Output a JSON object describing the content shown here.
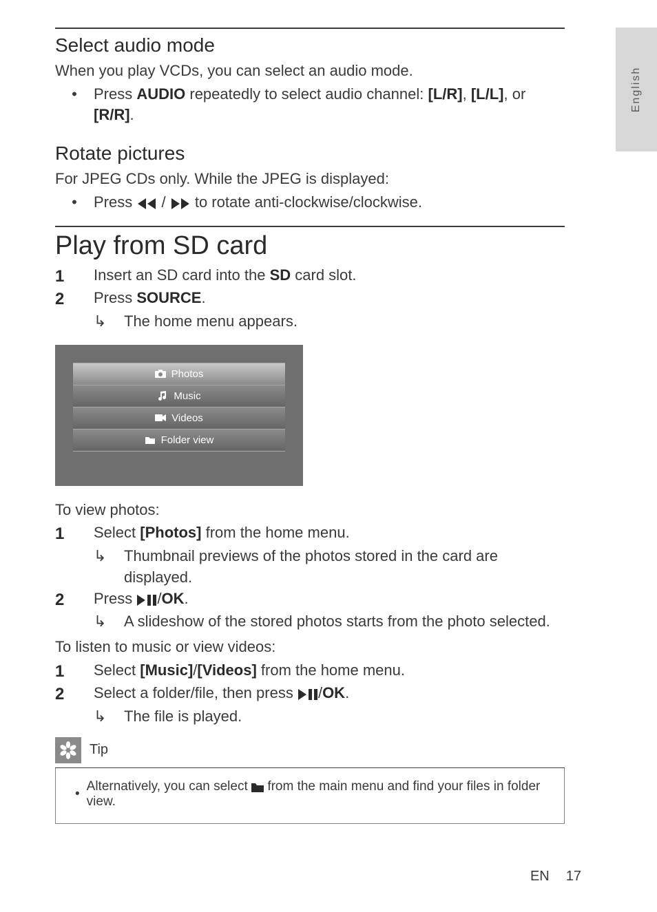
{
  "side_tab": "English",
  "sec_audio": {
    "heading": "Select audio mode",
    "intro": "When you play VCDs, you can select an audio mode.",
    "bullet_pre": "Press ",
    "bullet_bold": "AUDIO",
    "bullet_mid": " repeatedly to select audio channel: ",
    "opt1": "[L/R]",
    "sep": ", ",
    "opt2": "[L/L]",
    "sep2": ", or ",
    "opt3": "[R/R]",
    "period": "."
  },
  "sec_rotate": {
    "heading": "Rotate pictures",
    "intro": "For JPEG CDs only. While the JPEG is displayed:",
    "bullet_pre": "Press ",
    "bullet_mid": "/ ",
    "bullet_post": " to rotate anti-clockwise/clockwise."
  },
  "sec_sd": {
    "heading": "Play from SD card",
    "step1_pre": "Insert an SD card into the ",
    "step1_bold": "SD",
    "step1_post": " card slot.",
    "step2_pre": "Press ",
    "step2_bold": "SOURCE",
    "step2_post": ".",
    "step2_sub": "The home menu appears.",
    "menu": {
      "photos": "Photos",
      "music": "Music",
      "videos": "Videos",
      "folder": "Folder view"
    },
    "photos_intro": "To view photos:",
    "p_step1_pre": "Select ",
    "p_step1_bold": "[Photos]",
    "p_step1_post": " from the home menu.",
    "p_step1_sub": "Thumbnail previews of the photos stored in the card are displayed.",
    "p_step2_pre": "Press ",
    "p_step2_mid": "/",
    "p_step2_bold": "OK",
    "p_step2_post": ".",
    "p_step2_sub": "A slideshow of the stored photos starts from the photo selected.",
    "music_intro": "To listen to music or view videos:",
    "m_step1_pre": "Select ",
    "m_step1_b1": "[Music]",
    "m_step1_sep": "/",
    "m_step1_b2": "[Videos]",
    "m_step1_post": " from the home menu.",
    "m_step2_pre": "Select a folder/file, then press ",
    "m_step2_mid": "/",
    "m_step2_bold": "OK",
    "m_step2_post": ".",
    "m_step2_sub": "The file is played."
  },
  "tip": {
    "label": "Tip",
    "pre": "Alternatively, you can select ",
    "post": " from the main menu and find your files in folder view."
  },
  "footer": {
    "lang": "EN",
    "page": "17"
  }
}
